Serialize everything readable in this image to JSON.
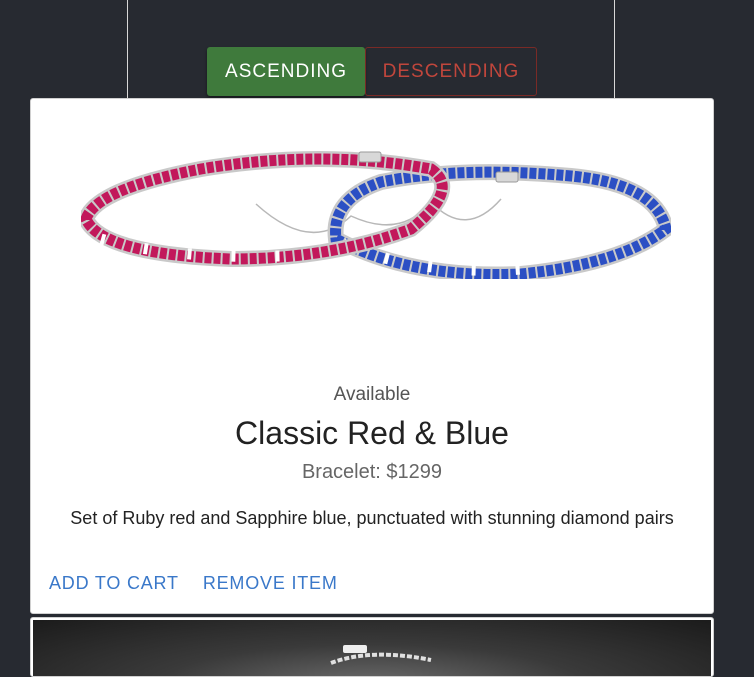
{
  "sort": {
    "ascending_label": "ASCENDING",
    "descending_label": "DESCENDING"
  },
  "products": [
    {
      "availability": "Available",
      "title": "Classic Red & Blue",
      "subtitle": "Bracelet: $1299",
      "description": "Set of Ruby red and Sapphire blue, punctuated with stunning diamond pairs",
      "add_to_cart_label": "ADD TO CART",
      "remove_label": "REMOVE ITEM",
      "image_icon": "bracelet-ruby-sapphire-photo"
    }
  ],
  "colors": {
    "background": "#272a31",
    "ascending_button": "#3f7a3c",
    "descending_text": "#c0463c",
    "link": "#3a78c9",
    "ruby": "#c2185b",
    "sapphire": "#2b4fc4"
  }
}
